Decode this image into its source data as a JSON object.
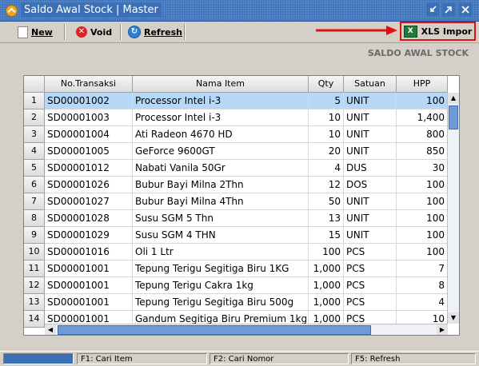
{
  "window": {
    "title": "Saldo Awal Stock | Master"
  },
  "toolbar": {
    "new_label": "New",
    "void_label": "Void",
    "refresh_label": "Refresh",
    "import_label": "XLS Impor"
  },
  "section_title": "SALDO AWAL STOCK",
  "grid": {
    "columns": [
      "",
      "No.Transaksi",
      "Nama Item",
      "Qty",
      "Satuan",
      "HPP"
    ],
    "selected_row": 1,
    "rows": [
      {
        "no": "1",
        "trx": "SD00001002",
        "item": "Processor Intel i-3",
        "qty": "5",
        "unit": "UNIT",
        "hpp": "100"
      },
      {
        "no": "2",
        "trx": "SD00001003",
        "item": "Processor Intel i-3",
        "qty": "10",
        "unit": "UNIT",
        "hpp": "1,400"
      },
      {
        "no": "3",
        "trx": "SD00001004",
        "item": "Ati Radeon 4670 HD",
        "qty": "10",
        "unit": "UNIT",
        "hpp": "800"
      },
      {
        "no": "4",
        "trx": "SD00001005",
        "item": "GeForce 9600GT",
        "qty": "20",
        "unit": "UNIT",
        "hpp": "850"
      },
      {
        "no": "5",
        "trx": "SD00001012",
        "item": "Nabati Vanila 50Gr",
        "qty": "4",
        "unit": "DUS",
        "hpp": "30"
      },
      {
        "no": "6",
        "trx": "SD00001026",
        "item": "Bubur Bayi Milna 2Thn",
        "qty": "12",
        "unit": "DOS",
        "hpp": "100"
      },
      {
        "no": "7",
        "trx": "SD00001027",
        "item": "Bubur Bayi Milna 4Thn",
        "qty": "50",
        "unit": "UNIT",
        "hpp": "100"
      },
      {
        "no": "8",
        "trx": "SD00001028",
        "item": "Susu SGM 5 Thn",
        "qty": "13",
        "unit": "UNIT",
        "hpp": "100"
      },
      {
        "no": "9",
        "trx": "SD00001029",
        "item": "Susu SGM 4 THN",
        "qty": "15",
        "unit": "UNIT",
        "hpp": "100"
      },
      {
        "no": "10",
        "trx": "SD00001016",
        "item": "Oli 1 Ltr",
        "qty": "100",
        "unit": "PCS",
        "hpp": "100"
      },
      {
        "no": "11",
        "trx": "SD00001001",
        "item": "Tepung Terigu Segitiga Biru 1KG",
        "qty": "1,000",
        "unit": "PCS",
        "hpp": "7"
      },
      {
        "no": "12",
        "trx": "SD00001001",
        "item": "Tepung Terigu Cakra 1kg",
        "qty": "1,000",
        "unit": "PCS",
        "hpp": "8"
      },
      {
        "no": "13",
        "trx": "SD00001001",
        "item": "Tepung Terigu Segitiga Biru 500g",
        "qty": "1,000",
        "unit": "PCS",
        "hpp": "4"
      },
      {
        "no": "14",
        "trx": "SD00001001",
        "item": "Gandum Segitiga Biru Premium 1kg",
        "qty": "1,000",
        "unit": "PCS",
        "hpp": "10"
      }
    ]
  },
  "statusbar": {
    "f1": "F1: Cari Item",
    "f2": "F2: Cari Nomor",
    "f5": "F5: Refresh"
  },
  "colors": {
    "titlebar": "#3b6fb6",
    "selection": "#b7d7f7",
    "highlight_border": "#e01010"
  },
  "icons": [
    "app-icon",
    "new-icon",
    "void-icon",
    "refresh-icon",
    "xls-icon",
    "minimize-icon",
    "restore-icon",
    "close-icon",
    "arrow-icon"
  ]
}
